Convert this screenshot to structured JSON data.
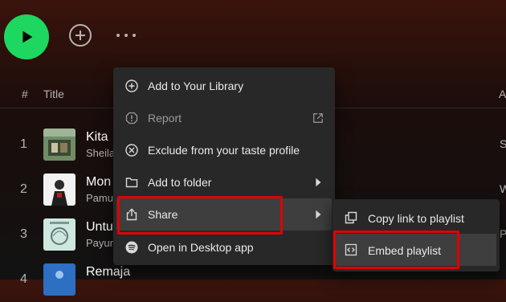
{
  "action_bar": {
    "play_icon": "play-icon",
    "add_icon": "plus-circle-icon",
    "more_icon": "more-horizontal-icon",
    "accent_color": "#1ed760"
  },
  "tracklist": {
    "header": {
      "number": "#",
      "title": "Title",
      "album_truncated": "A"
    },
    "tracks": [
      {
        "number": "1",
        "title": "Kita",
        "artist": "Sheila",
        "album_truncated": "S"
      },
      {
        "number": "2",
        "title": "Mon",
        "artist": "Pamu",
        "album_truncated": "W"
      },
      {
        "number": "3",
        "title": "Untu",
        "artist": "Payun",
        "album_truncated": "P"
      },
      {
        "number": "4",
        "title": "Remaja",
        "artist": "",
        "album_truncated": ""
      }
    ]
  },
  "context_menu": {
    "items": [
      {
        "label": "Add to Your Library",
        "icon": "plus-circle-icon"
      },
      {
        "label": "Report",
        "icon": "report-icon",
        "disabled": true,
        "trailing_icon": "external-link-icon"
      },
      {
        "label": "Exclude from your taste profile",
        "icon": "exclude-icon"
      },
      {
        "label": "Add to folder",
        "icon": "folder-icon",
        "trailing_icon": "chevron-right-icon"
      },
      {
        "label": "Share",
        "icon": "share-icon",
        "trailing_icon": "chevron-right-icon",
        "active": true
      },
      {
        "label": "Open in Desktop app",
        "icon": "spotify-icon"
      }
    ]
  },
  "share_submenu": {
    "items": [
      {
        "label": "Copy link to playlist",
        "icon": "copy-icon"
      },
      {
        "label": "Embed playlist",
        "icon": "embed-icon",
        "active": true
      }
    ]
  },
  "annotation_color": "#e00000"
}
